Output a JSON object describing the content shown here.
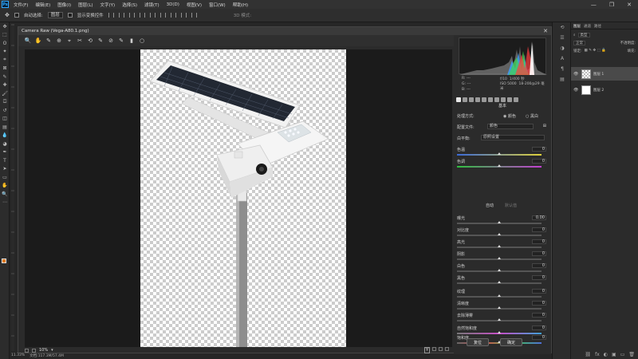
{
  "menubar": {
    "logo": "Ps",
    "items": [
      "文件(F)",
      "编辑(E)",
      "图像(I)",
      "图层(L)",
      "文字(Y)",
      "选择(S)",
      "滤镜(T)",
      "3D(D)",
      "视图(V)",
      "窗口(W)",
      "帮助(H)"
    ],
    "window_controls": [
      "—",
      "❐",
      "✕"
    ]
  },
  "options_bar": {
    "auto_select_label": "自动选择:",
    "auto_select_value": "图层",
    "show_transform_label": "显示变换控件",
    "mode_3d_label": "3D 模式:"
  },
  "camera_raw": {
    "title": "Camera Raw (Vega-A80.1.png)",
    "close_glyph": "✕",
    "tools": [
      "🔍",
      "✋",
      "✎",
      "⊕",
      "⌖",
      "✂",
      "⟲",
      "✎",
      "⊘",
      "✎",
      "▮",
      "○"
    ],
    "zoom": "10%",
    "zoom_arrow": "▾",
    "status_badge": "Y",
    "histogram": {
      "r_label": "R:",
      "g_label": "G:",
      "b_label": "B:",
      "r_val": "---",
      "g_val": "---",
      "b_val": "---",
      "aperture": "f/10",
      "shutter": "1/400 秒",
      "iso": "ISO 5000",
      "lens": "18-200@29 毫米"
    },
    "panel_title": "基本",
    "treatment_label": "处理方式:",
    "treatment_color": "颜色",
    "treatment_bw": "黑白",
    "profile_label": "配置文件:",
    "profile_value": "颜色",
    "wb_label": "白平衡:",
    "wb_value": "原照设置",
    "sliders": [
      {
        "label": "色温",
        "value": "0",
        "pos": 0.5,
        "style": "temp"
      },
      {
        "label": "色调",
        "value": "0",
        "pos": 0.5,
        "style": "tint"
      }
    ],
    "auto_label": "自动",
    "default_label": "默认值",
    "tone_sliders": [
      {
        "label": "曝光",
        "value": "0.00",
        "pos": 0.5
      },
      {
        "label": "对比度",
        "value": "0",
        "pos": 0.5
      },
      {
        "label": "高光",
        "value": "0",
        "pos": 0.5
      },
      {
        "label": "阴影",
        "value": "0",
        "pos": 0.5
      },
      {
        "label": "白色",
        "value": "0",
        "pos": 0.5
      },
      {
        "label": "黑色",
        "value": "0",
        "pos": 0.5
      }
    ],
    "presence_sliders": [
      {
        "label": "纹理",
        "value": "0",
        "pos": 0.5
      },
      {
        "label": "清晰度",
        "value": "0",
        "pos": 0.5
      },
      {
        "label": "去除薄雾",
        "value": "0",
        "pos": 0.5
      }
    ],
    "color_sliders": [
      {
        "label": "自然饱和度",
        "value": "0",
        "pos": 0.5,
        "style": "vib"
      },
      {
        "label": "饱和度",
        "value": "0",
        "pos": 0.5,
        "style": "sat"
      }
    ],
    "reset_button": "复位",
    "ok_button": "确定"
  },
  "layers_panel": {
    "tabs": [
      "图层",
      "通道",
      "路径"
    ],
    "kind_label": "类型",
    "blend_mode": "正常",
    "opacity_label": "不透明度:",
    "lock_label": "锁定:",
    "fill_label": "填充:",
    "layers": [
      {
        "name": "图层 1",
        "selected": true,
        "thumb": "chk"
      },
      {
        "name": "图层 2",
        "selected": false,
        "thumb": "wht"
      }
    ],
    "eye_glyph": "👁",
    "footer_icons": [
      "⛓",
      "fx",
      "◐",
      "▣",
      "▭",
      "🗑"
    ]
  },
  "statusbar": {
    "zoom": "11.33%",
    "doc": "文档:117.3M/57.4M"
  },
  "colors": {
    "foreground": "#e07a1f",
    "background": "#ffffff"
  }
}
